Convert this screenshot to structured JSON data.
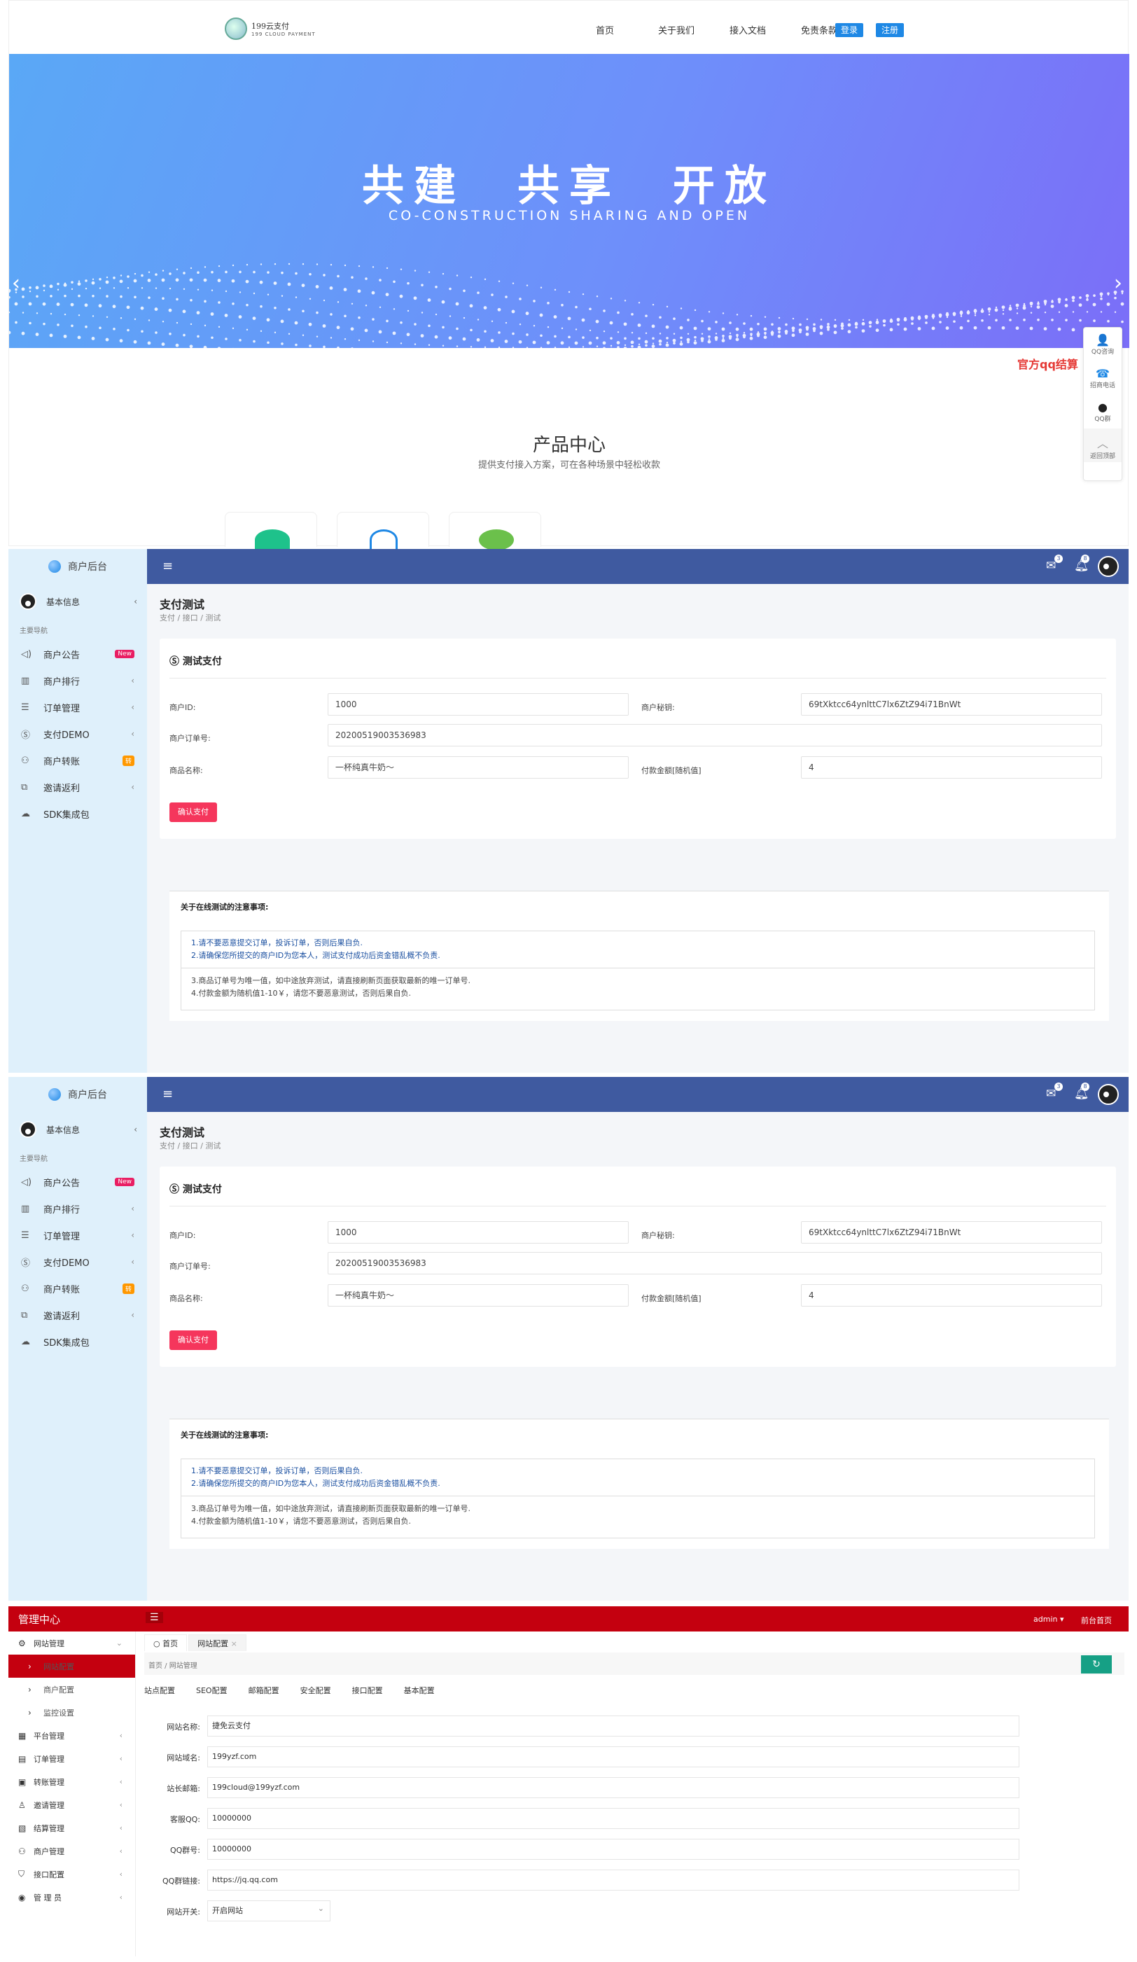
{
  "site": {
    "logo_text": "199云支付",
    "logo_sub": "199 CLOUD PAYMENT",
    "nav": [
      "首页",
      "关于我们",
      "接入文档",
      "免责条款"
    ],
    "login": "登录",
    "register": "注册",
    "banner_title": "共建　共享　开放",
    "banner_sub": "CO-CONSTRUCTION SHARING AND OPEN",
    "promo": "官方qq结算",
    "float": [
      {
        "label": "QQ咨询",
        "icon": "qq-icon"
      },
      {
        "label": "招商电话",
        "icon": "phone-icon"
      },
      {
        "label": "QQ群",
        "icon": "qq-group-icon"
      },
      {
        "label": "返回顶部",
        "icon": "arrow-up-icon"
      }
    ],
    "product_title": "产品中心",
    "product_sub": "提供支付接入方案，可在各种场景中轻松收款"
  },
  "merchant": {
    "sidebar_title": "商户后台",
    "user_label": "基本信息",
    "section_label": "主要导航",
    "items": [
      {
        "label": "商户公告",
        "icon": "speaker-icon",
        "badge": "New"
      },
      {
        "label": "商户排行",
        "icon": "bar-chart-icon"
      },
      {
        "label": "订单管理",
        "icon": "list-icon"
      },
      {
        "label": "支付DEMO",
        "icon": "dollar-icon"
      },
      {
        "label": "商户转账",
        "icon": "transfer-icon",
        "badge": "转"
      },
      {
        "label": "邀请返利",
        "icon": "share-icon"
      },
      {
        "label": "SDK集成包",
        "icon": "cloud-icon"
      }
    ],
    "mail_count": "3",
    "bell_count": "8",
    "page_title": "支付测试",
    "breadcrumb": "支付  /  接口  /  测试",
    "card_title": "测试支付",
    "fields": {
      "merchant_id_label": "商户ID:",
      "merchant_id": "1000",
      "merchant_key_label": "商户秘钥:",
      "merchant_key": "69tXktcc64ynlttC7lx6ZtZ94i71BnWt",
      "order_no_label": "商户订单号:",
      "order_no": "20200519003536983",
      "product_label": "商品名称:",
      "product": "一杯纯真牛奶～",
      "amount_label": "付款金额[随机值]",
      "amount": "4"
    },
    "pay_button": "确认支付",
    "notice_title": "关于在线测试的注意事项:",
    "notices": [
      "1.请不要恶意提交订单，投诉订单，否则后果自负.",
      "2.请确保您所提交的商户ID为您本人，测试支付成功后资金错乱概不负责.",
      "3.商品订单号为唯一值，如中途放弃测试，请直接刷新页面获取最新的唯一订单号.",
      "4.付款金额为随机值1-10￥，请您不要恶意测试，否则后果自负."
    ]
  },
  "admin": {
    "brand": "管理中心",
    "user": "admin",
    "home": "前台首页",
    "sidebar": [
      {
        "label": "网站管理",
        "icon": "settings-icon"
      },
      {
        "label": "网站配置",
        "active": true
      },
      {
        "label": "商户配置"
      },
      {
        "label": "监控设置"
      },
      {
        "label": "平台管理",
        "icon": "grid-icon"
      },
      {
        "label": "订单管理",
        "icon": "order-icon"
      },
      {
        "label": "转账管理",
        "icon": "transfer-icon"
      },
      {
        "label": "邀请管理",
        "icon": "user-icon"
      },
      {
        "label": "结算管理",
        "icon": "settle-icon"
      },
      {
        "label": "商户管理",
        "icon": "shop-icon"
      },
      {
        "label": "接口配置",
        "icon": "shield-icon"
      },
      {
        "label": "管 理 员",
        "icon": "admin-icon"
      }
    ],
    "tabs": [
      "首页",
      "网站配置"
    ],
    "breadcrumb": "首页  /  网站管理",
    "subtabs": [
      "站点配置",
      "SEO配置",
      "邮箱配置",
      "安全配置",
      "接口配置",
      "基本配置"
    ],
    "form": [
      {
        "label": "网站名称:",
        "value": "捷免云支付"
      },
      {
        "label": "网站域名:",
        "value": "199yzf.com"
      },
      {
        "label": "站长邮箱:",
        "value": "199cloud@199yzf.com"
      },
      {
        "label": "客服QQ:",
        "value": "10000000"
      },
      {
        "label": "QQ群号:",
        "value": "10000000"
      },
      {
        "label": "QQ群链接:",
        "value": "https://jq.qq.com"
      },
      {
        "label": "网站开关:",
        "value": "开启网站",
        "select": true
      }
    ]
  }
}
